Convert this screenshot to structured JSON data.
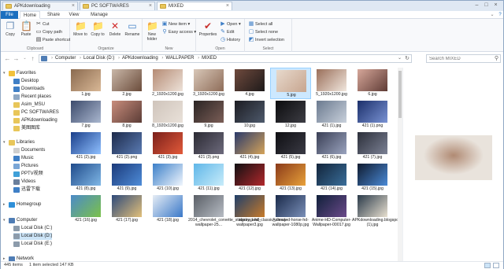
{
  "window_tabs": [
    {
      "label": "APKdownloading",
      "active": false
    },
    {
      "label": "PC SOFTWARES",
      "active": false
    },
    {
      "label": "MIXED",
      "active": true
    }
  ],
  "ribbon_tabs": [
    "File",
    "Home",
    "Share",
    "View",
    "Manage"
  ],
  "ribbon": {
    "clipboard": {
      "label": "Clipboard",
      "copy": "Copy",
      "paste": "Paste",
      "cut": "Cut",
      "copy_path": "Copy path",
      "paste_shortcut": "Paste shortcut"
    },
    "organize": {
      "label": "Organize",
      "move_to": "Move to",
      "copy_to": "Copy to",
      "delete": "Delete",
      "rename": "Rename"
    },
    "new": {
      "label": "New",
      "new_folder": "New folder",
      "new_item": "New item ▾",
      "easy_access": "Easy access ▾"
    },
    "open": {
      "label": "Open",
      "properties": "Properties",
      "open": "Open ▾",
      "edit": "Edit",
      "history": "History"
    },
    "select": {
      "label": "Select",
      "select_all": "Select all",
      "select_none": "Select none",
      "invert_selection": "Invert selection"
    }
  },
  "address": {
    "crumbs": [
      "Computer",
      "Local Disk (D:)",
      "APKdownloading",
      "WALLPAPER",
      "MIXED"
    ]
  },
  "search": {
    "placeholder": "Search MIXED"
  },
  "nav": [
    {
      "label": "Favorites",
      "icon": "star-icon",
      "color": "#f2c13b"
    },
    {
      "label": "Desktop",
      "icon": "desktop-icon",
      "color": "#3f7fc6"
    },
    {
      "label": "Downloads",
      "icon": "downloads-icon",
      "color": "#3f7fc6"
    },
    {
      "label": "Recent places",
      "icon": "recent-icon",
      "color": "#8fa8c4"
    },
    {
      "label": "Asim_MSU",
      "icon": "folder-icon",
      "color": "#e8c65a"
    },
    {
      "label": "PC SOFTWARES",
      "icon": "folder-icon",
      "color": "#e8c65a"
    },
    {
      "label": "APKdownloading",
      "icon": "folder-icon",
      "color": "#e8c65a"
    },
    {
      "label": "美图图库",
      "icon": "folder-icon",
      "color": "#e8c65a"
    },
    {
      "label": "Libraries",
      "icon": "libraries-icon",
      "color": "#e8c65a"
    },
    {
      "label": "Documents",
      "icon": "documents-icon",
      "color": "#cfcfcf"
    },
    {
      "label": "Music",
      "icon": "music-icon",
      "color": "#3f7fc6"
    },
    {
      "label": "Pictures",
      "icon": "pictures-icon",
      "color": "#7aa6d6"
    },
    {
      "label": "PPTV视频",
      "icon": "video-icon",
      "color": "#3fa0d8"
    },
    {
      "label": "Videos",
      "icon": "videos-icon",
      "color": "#6a7f9c"
    },
    {
      "label": "迅雷下载",
      "icon": "download-folder-icon",
      "color": "#3f7fc6"
    },
    {
      "label": "Homegroup",
      "icon": "homegroup-icon",
      "color": "#2e8fd8"
    },
    {
      "label": "Computer",
      "icon": "computer-icon",
      "color": "#4f7db5"
    },
    {
      "label": "Local Disk (C:)",
      "icon": "disk-icon",
      "color": "#8c9bab"
    },
    {
      "label": "Local Disk (D:)",
      "icon": "disk-icon",
      "color": "#8c9bab"
    },
    {
      "label": "Local Disk (E:)",
      "icon": "disk-icon",
      "color": "#8c9bab"
    },
    {
      "label": "Network",
      "icon": "network-icon",
      "color": "#4f7db5"
    }
  ],
  "files": [
    {
      "name": "1.jpg",
      "c1": "#8a6a4f",
      "c2": "#d9b896"
    },
    {
      "name": "2.jpg",
      "c1": "#c9b7a8",
      "c2": "#6b4c3b"
    },
    {
      "name": "2_1920x1200.jpg",
      "c1": "#b58b74",
      "c2": "#ede2d9"
    },
    {
      "name": "3_1920x1200.jpg",
      "c1": "#d8c7b8",
      "c2": "#8e6c58"
    },
    {
      "name": "4.jpg",
      "c1": "#6f4a3d",
      "c2": "#1e1a1a"
    },
    {
      "name": "5.jpg",
      "c1": "#e7d9cc",
      "c2": "#c7a58f"
    },
    {
      "name": "5_1920x1200.jpg",
      "c1": "#9a6f5a",
      "c2": "#f1e7de"
    },
    {
      "name": "6.jpg",
      "c1": "#d6a79a",
      "c2": "#5f3b35"
    },
    {
      "name": "7.jpg",
      "c1": "#3c4a6b",
      "c2": "#aab7cf"
    },
    {
      "name": "8.jpg",
      "c1": "#c98d7c",
      "c2": "#5b3c36"
    },
    {
      "name": "8_1920x1200.jpg",
      "c1": "#cfc4bb",
      "c2": "#e9e1d9"
    },
    {
      "name": "9.jpg",
      "c1": "#2a2423",
      "c2": "#7b5e57"
    },
    {
      "name": "10.jpg",
      "c1": "#1c1c22",
      "c2": "#4e5a6c"
    },
    {
      "name": "12.jpg",
      "c1": "#0c0c0e",
      "c2": "#3d3d44"
    },
    {
      "name": "421 (1).jpg",
      "c1": "#6b7a8f",
      "c2": "#c8d0db"
    },
    {
      "name": "421 (1).png",
      "c1": "#1b2f6a",
      "c2": "#7a93d4"
    },
    {
      "name": "421 (2).jpg",
      "c1": "#1a3e8a",
      "c2": "#8fc0ff"
    },
    {
      "name": "421 (2).png",
      "c1": "#1d2a4a",
      "c2": "#5a7bb3"
    },
    {
      "name": "421 (3).jpg",
      "c1": "#7a1f1a",
      "c2": "#e25a3a"
    },
    {
      "name": "421 (3).png",
      "c1": "#2b2a33",
      "c2": "#6d6a7c"
    },
    {
      "name": "421 (4).jpg",
      "c1": "#2a3a6a",
      "c2": "#d4a35a"
    },
    {
      "name": "421 (5).jpg",
      "c1": "#0e0e12",
      "c2": "#3a3a44"
    },
    {
      "name": "421 (6).jpg",
      "c1": "#3a3f55",
      "c2": "#9aa3be"
    },
    {
      "name": "421 (7).jpg",
      "c1": "#2c2f3a",
      "c2": "#7b8194"
    },
    {
      "name": "421 (8).jpg",
      "c1": "#1f4a8a",
      "c2": "#7fb7e6"
    },
    {
      "name": "421 (9).jpg",
      "c1": "#1b3a7a",
      "c2": "#4e8cd8"
    },
    {
      "name": "421 (10).jpg",
      "c1": "#3b7fc8",
      "c2": "#f0f6fd"
    },
    {
      "name": "421 (11).jpg",
      "c1": "#5fb6e8",
      "c2": "#c8ecfa"
    },
    {
      "name": "421 (12).jpg",
      "c1": "#101012",
      "c2": "#b2282c"
    },
    {
      "name": "421 (13).jpg",
      "c1": "#8a3a1a",
      "c2": "#e8a13a"
    },
    {
      "name": "421 (14).jpg",
      "c1": "#12243a",
      "c2": "#3a6e9a"
    },
    {
      "name": "421 (15).jpg",
      "c1": "#0f1a2e",
      "c2": "#4a8ad6"
    },
    {
      "name": "421 (16).jpg",
      "c1": "#4b8ac8",
      "c2": "#7bc14a"
    },
    {
      "name": "421 (17).jpg",
      "c1": "#2e4a7a",
      "c2": "#e2c07a"
    },
    {
      "name": "421 (18).jpg",
      "c1": "#e6edf5",
      "c2": "#3a78c8"
    },
    {
      "name": "2014_chevrolet_corvette_stingray_and_classic_chevy-wallpaper-25...",
      "c1": "#5a5f66",
      "c2": "#b7bcc4"
    },
    {
      "name": "abstract-hd-wallpaper3.jpg",
      "c1": "#1f3f6a",
      "c2": "#c77a2a"
    },
    {
      "name": "Animated-horse-hd-wallpaper-1080p.jpg",
      "c1": "#1a2a4a",
      "c2": "#7a8fb8"
    },
    {
      "name": "Anime-HD-Computer-Wallpaper-00017.jpg",
      "c1": "#10203a",
      "c2": "#6b4a8a"
    },
    {
      "name": "APKdownloading.blogspot.com (1).jpg",
      "c1": "#2a3a4a",
      "c2": "#e8e0d0"
    }
  ],
  "preview": {
    "c1": "#e9e3dc",
    "c2": "#b08a73"
  },
  "status": {
    "count": "445 items",
    "selected": "1 item selected  147 KB"
  }
}
